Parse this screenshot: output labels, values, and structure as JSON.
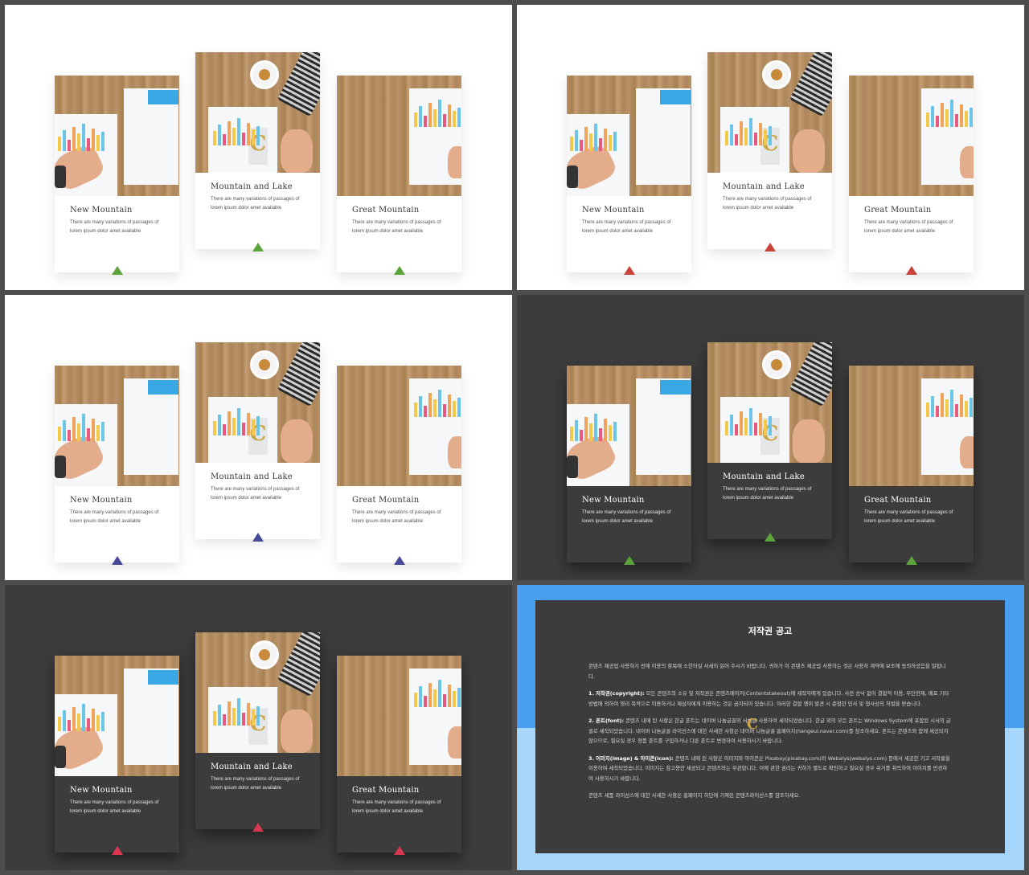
{
  "colors": {
    "frame": "#4d4d4d",
    "light_bg": "#ffffff",
    "dark_bg": "#3c3c3c",
    "notice_top": "#4a9ef0",
    "notice_bottom": "#a6d6fb"
  },
  "cards": [
    {
      "title": "New Mountain",
      "text": "There are many variations of passages of lorem ipsum dolor amet available"
    },
    {
      "title": "Mountain and Lake",
      "text": "There are many variations of passages of lorem ipsum dolor amet available"
    },
    {
      "title": "Great Mountain",
      "text": "There are many variations of passages of lorem ipsum dolor amet available"
    }
  ],
  "slides": [
    {
      "theme": "light",
      "accent_colors": [
        "#5ba33b",
        "#5ba33b",
        "#5ba33b"
      ]
    },
    {
      "theme": "light",
      "accent_colors": [
        "#c8443a",
        "#c8443a",
        "#c8443a"
      ]
    },
    {
      "theme": "light",
      "accent_colors": [
        "#46499a",
        "#46499a",
        "#46499a"
      ]
    },
    {
      "theme": "dark",
      "accent_colors": [
        "#5ba33b",
        "#5ba33b",
        "#5ba33b"
      ]
    },
    {
      "theme": "dark",
      "accent_colors": [
        "#d9364f",
        "#d9364f",
        "#d9364f"
      ]
    }
  ],
  "notice": {
    "title": "저작권 공고",
    "intro": "콘텐츠 제공업 사용하기 전에 이용의 항목에 소한하실 사세히 읽어 주시기 바랍니다. 귀하가 이 콘텐츠 제공업 사용하는 것은 사용자 계약에 보조에 동의하셨음을 말합니다.",
    "p1_label": "1. 저작권(copyright):",
    "p1": "모든 콘텐츠의 소유 및 저작권은 콘텐츠메이커(Contentstakeout)에 세작자에게 있습니다. 사전 승낙 없이 결합적 이용, 무단전재, 배포 기타 방법에 의하여 영리 목적으로 이용하거나 제삼자에게 이용하는 것은 금지되어 있습니다. 이러한 결합 행위 발견 시 준엄한 민사 및 형사상의 처벌을 받습니다.",
    "p2_label": "2. 폰트(font):",
    "p2": "콘텐츠 내에 된 사항은 한글 폰트는 네이버 나눔글꼴의 서체를 사용하여 세작되었습니다. 한글 외의 모든 폰트는 Windows System에 포함된 시서의 글꼴로 세작되었습니다. 네이버 나눔글꼴 라이선스에 대한 사세한 사항은 네이버 나눔글꼴 홈페이지(hangeul.naver.com)를 참조하세요. 폰트는 콘텐츠와 함께 세공되지 않으므로, 필요실 경우 정품 폰트를 구입하거나 다른 폰트로 변경하여 사용하시기 바랍니다.",
    "p3_label": "3. 이미지(image) & 아이콘(icon):",
    "p3": "콘텐츠 내에 된 사항은 이미지와 아이콘은 Pixabay(pixabay.com)와 Webalys(webalys.com) 등에서 세공한 기고 서작물을 이용하여 세작되었습니다. 이미지는 참고용만 세공되고 콘텐츠와는 무관합니다. 이에 관한 권리는 귀하가 별도로 확인하고 필요실 경우 쉬거를 취득하여 이미지를 반경하여 사용하시기 바랍니다.",
    "outro": "콘텐츠 세품 라이선스에 대한 사세한 사항은 홈페이지 하단에 기재된 콘텐츠라이선스를 참조하세요.",
    "logo": "C"
  }
}
